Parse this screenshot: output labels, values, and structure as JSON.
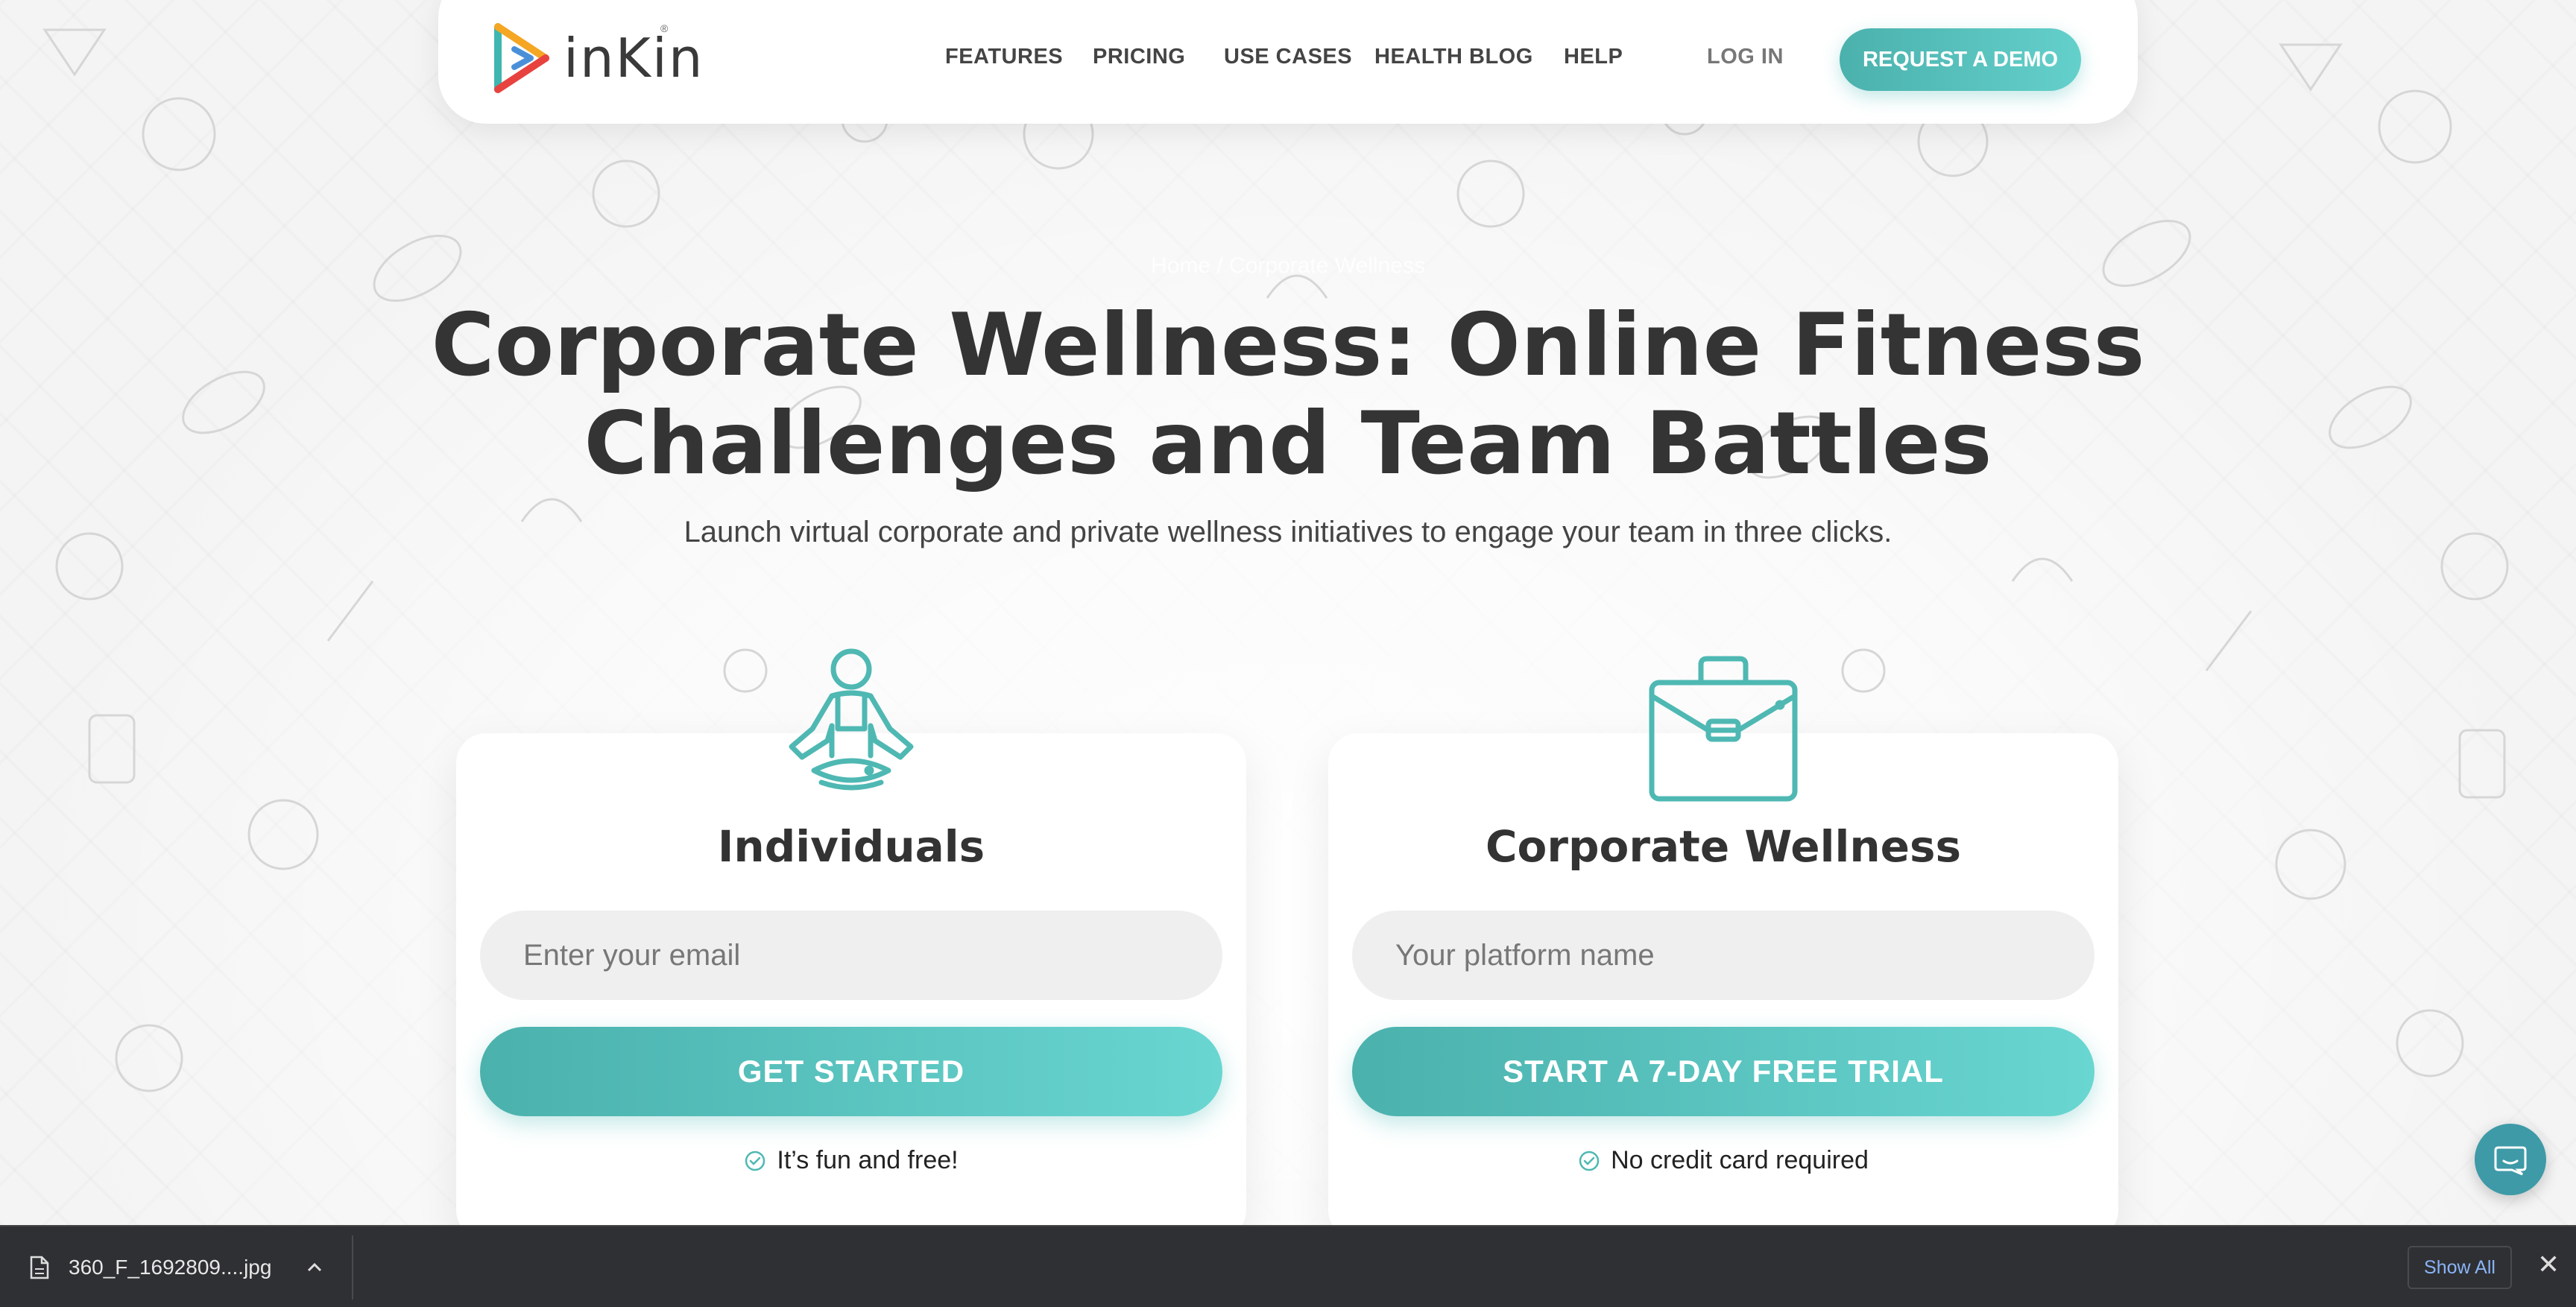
{
  "brand": {
    "name": "inKin",
    "registered": "®"
  },
  "nav": {
    "items": [
      "FEATURES",
      "PRICING",
      "USE CASES",
      "HEALTH BLOG",
      "HELP"
    ],
    "login": "LOG IN",
    "demo": "REQUEST A DEMO"
  },
  "hero": {
    "breadcrumb": "Home / Corporate Wellness",
    "title_line1": "Corporate Wellness: Online Fitness",
    "title_line2": "Challenges and Team Battles",
    "subtitle": "Launch virtual corporate and private wellness initiatives to engage your team in three clicks."
  },
  "cards": [
    {
      "icon": "meditation-person-icon",
      "title": "Individuals",
      "placeholder": "Enter your email",
      "button": "GET STARTED",
      "note": "It’s fun and free!"
    },
    {
      "icon": "briefcase-icon",
      "title": "Corporate Wellness",
      "placeholder": "Your platform name",
      "button": "START A 7-DAY FREE TRIAL",
      "note": "No credit card required"
    }
  ],
  "download_bar": {
    "file_name": "360_F_1692809....jpg",
    "show_all": "Show All",
    "close": "✕"
  },
  "colors": {
    "accent": "#4bb1ad",
    "accent_light": "#69d6d1",
    "text_dark": "#343434",
    "chat": "#3e9aa7",
    "bar": "#2f3033"
  }
}
